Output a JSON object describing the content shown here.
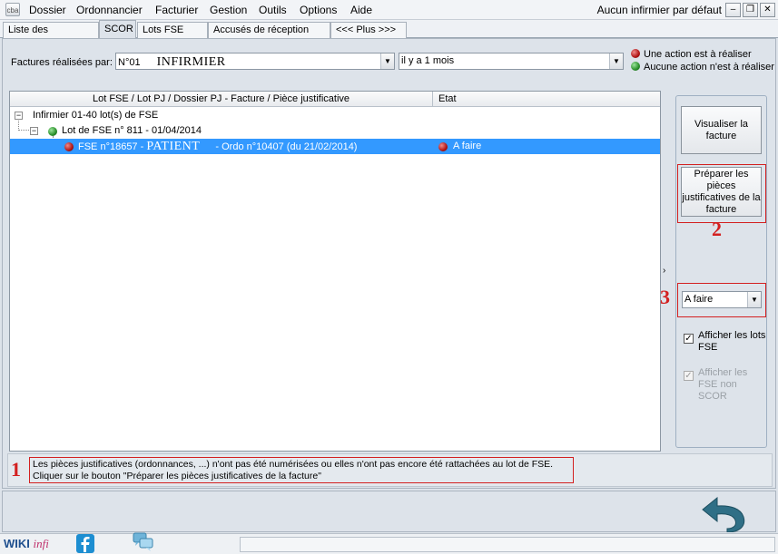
{
  "menu": {
    "items": [
      "Dossier",
      "Ordonnancier",
      "Facturier",
      "Gestion",
      "Outils",
      "Options",
      "Aide"
    ],
    "window_status": "Aucun infirmier par défaut",
    "app_icon_label": "cba"
  },
  "tabs": [
    "Liste des paiements",
    "SCOR",
    "Lots FSE émis",
    "Accusés de réception FSE",
    "<<< Plus >>>"
  ],
  "active_tab": "SCOR",
  "filters": {
    "label": "Factures réalisées par:",
    "nurse_number": "N°01",
    "nurse_name": "INFIRMIER",
    "period": "il y a 1 mois"
  },
  "legend": {
    "red": "Une action est à réaliser",
    "green": "Aucune action n'est à réaliser"
  },
  "grid": {
    "col_main": "Lot FSE / Lot PJ / Dossier PJ - Facture / Pièce justificative",
    "col_state": "Etat",
    "rows": {
      "root": "Infirmier 01-40 lot(s) de FSE",
      "lot": "Lot de FSE n° 811 - 01/04/2014",
      "fse_prefix": "FSE n°18657 -",
      "fse_patient": "PATIENT",
      "fse_suffix": "- Ordo n°10407 (du 21/02/2014)",
      "fse_state": "A faire"
    }
  },
  "side": {
    "btn_view": "Visualiser la facture",
    "btn_prepare": "Préparer les pièces justificatives de la facture",
    "status_select": "A faire",
    "chk_lots_label": "Afficher les lots FSE",
    "chk_nonscor_label": "Afficher les FSE non SCOR",
    "annotation_2": "2",
    "annotation_3": "3"
  },
  "message": {
    "annotation_1": "1",
    "line1": "Les pièces justificatives (ordonnances, ...) n'ont pas été numérisées ou elles n'ont pas encore été rattachées au lot de FSE.",
    "line2": "Cliquer sur le bouton \"Préparer les pièces justificatives de la facture\""
  },
  "footer": {
    "wiki_a": "WIKI",
    "wiki_b": "infi"
  },
  "colors": {
    "selection": "#3399ff",
    "annotation_red": "#d32020",
    "return_arrow": "#2f6f86"
  }
}
